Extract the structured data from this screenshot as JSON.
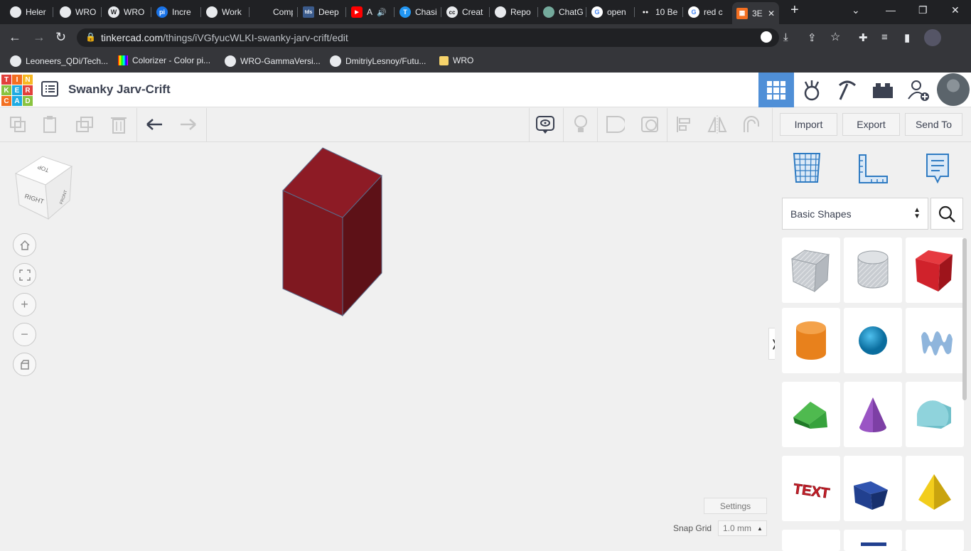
{
  "browser": {
    "tabs": [
      {
        "label": "Heler",
        "icon": "github-icon"
      },
      {
        "label": "WRO",
        "icon": "github-icon"
      },
      {
        "label": "WRO",
        "icon": "wordpress-icon"
      },
      {
        "label": "Incre",
        "icon": "pi-icon"
      },
      {
        "label": "Work",
        "icon": "github-icon"
      },
      {
        "label": "Comp",
        "icon": "blank-icon"
      },
      {
        "label": "Deep",
        "icon": "tds-icon"
      },
      {
        "label": "A",
        "icon": "youtube-icon"
      },
      {
        "label": "Chasi",
        "icon": "t-icon"
      },
      {
        "label": "Creat",
        "icon": "cc-icon"
      },
      {
        "label": "Repo",
        "icon": "github-icon"
      },
      {
        "label": "ChatG",
        "icon": "chatgpt-icon"
      },
      {
        "label": "open",
        "icon": "google-icon"
      },
      {
        "label": "10 Be",
        "icon": "medium-icon"
      },
      {
        "label": "red c",
        "icon": "google-icon"
      },
      {
        "label": "3E",
        "icon": "tinkercad-icon"
      }
    ],
    "tab_fav_text": [
      "",
      "",
      "W",
      "pi",
      "",
      "",
      "tds",
      "▶",
      "T",
      "cc",
      "",
      "",
      "G",
      "●●",
      "G",
      "▦"
    ],
    "new_tab": "+",
    "url_host": "tinkercad.com",
    "url_path": "/things/iVGfyucWLKI-swanky-jarv-crift/edit",
    "bookmarks": [
      {
        "label": "Leoneers_QDi/Tech...",
        "icon": "github-icon"
      },
      {
        "label": "Colorizer - Color pi...",
        "icon": "colorizer-icon"
      },
      {
        "label": "WRO-GammaVersi...",
        "icon": "github-icon"
      },
      {
        "label": "DmitriyLesnoy/Futu...",
        "icon": "github-icon"
      },
      {
        "label": "WRO",
        "icon": "folder-icon"
      }
    ]
  },
  "app": {
    "logo_letters": [
      "T",
      "I",
      "N",
      "K",
      "E",
      "R",
      "C",
      "A",
      "D"
    ],
    "logo_colors": [
      "#e2403b",
      "#f36f21",
      "#f6b823",
      "#89c33f",
      "#1eabe3",
      "#e2403b",
      "#f36f21",
      "#1eabe3",
      "#89c33f"
    ],
    "project_title": "Swanky Jarv-Crift",
    "accent": "#4f8fd7"
  },
  "toolbar": {
    "import_label": "Import",
    "export_label": "Export",
    "send_to_label": "Send To"
  },
  "panel": {
    "category": "Basic Shapes",
    "shapes": [
      {
        "name": "Box Hole",
        "color": "#b9bec4"
      },
      {
        "name": "Cylinder Hole",
        "color": "#c5c9ce"
      },
      {
        "name": "Box",
        "color": "#d0222b"
      },
      {
        "name": "Cylinder",
        "color": "#e8811c"
      },
      {
        "name": "Sphere",
        "color": "#1a8ec4"
      },
      {
        "name": "Scribble",
        "color": "#8fb5dc"
      },
      {
        "name": "Roof",
        "color": "#36a23c"
      },
      {
        "name": "Cone",
        "color": "#7d3fa5"
      },
      {
        "name": "Round Roof",
        "color": "#6fbfc9"
      },
      {
        "name": "Text",
        "color": "#c8202a"
      },
      {
        "name": "Half Sphere",
        "color": "#21408f"
      },
      {
        "name": "Pyramid",
        "color": "#f2cd1c"
      }
    ],
    "text_shape_label": "TEXT"
  },
  "workplane": {
    "viewcube_top": "TOP",
    "viewcube_right": "RIGHT",
    "viewcube_front": "FRONT",
    "object_color": "#8b1a24",
    "settings_label": "Settings",
    "snap_grid_label": "Snap Grid",
    "snap_grid_value": "1.0 mm",
    "collapse_glyph": "❭"
  }
}
